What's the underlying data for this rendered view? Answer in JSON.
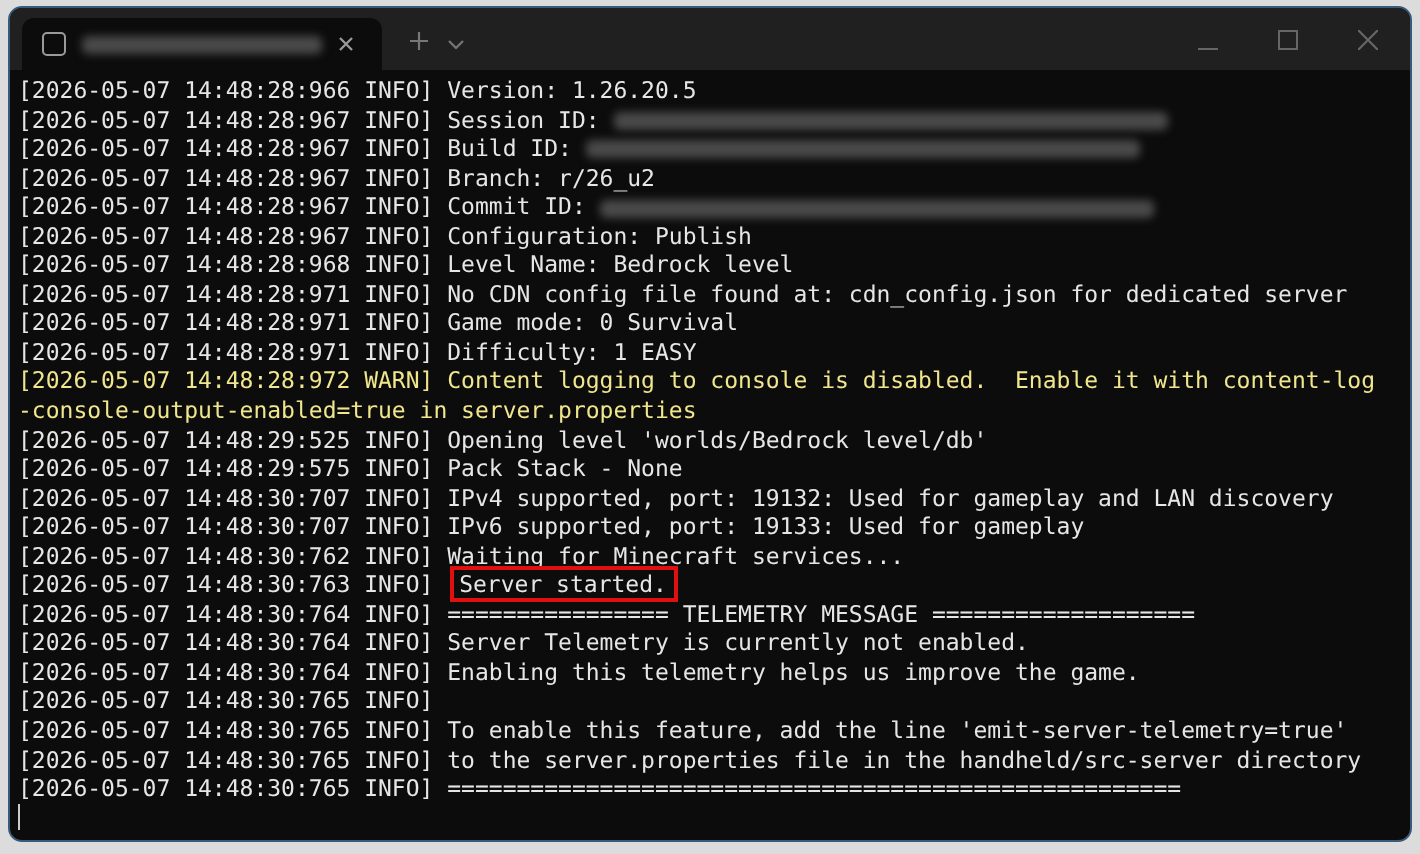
{
  "window": {
    "tab": {
      "title_redacted": true,
      "selected": true
    }
  },
  "console": {
    "lines": [
      {
        "time": "[2026-05-07 14:48:28:966",
        "level": "INFO]",
        "message": "Version: 1.26.20.5"
      },
      {
        "time": "[2026-05-07 14:48:28:967",
        "level": "INFO]",
        "message": "Session ID:",
        "redacted": true
      },
      {
        "time": "[2026-05-07 14:48:28:967",
        "level": "INFO]",
        "message": "Build ID:",
        "redacted": true
      },
      {
        "time": "[2026-05-07 14:48:28:967",
        "level": "INFO]",
        "message": "Branch: r/26_u2"
      },
      {
        "time": "[2026-05-07 14:48:28:967",
        "level": "INFO]",
        "message": "Commit ID:",
        "redacted": true
      },
      {
        "time": "[2026-05-07 14:48:28:967",
        "level": "INFO]",
        "message": "Configuration: Publish"
      },
      {
        "time": "[2026-05-07 14:48:28:968",
        "level": "INFO]",
        "message": "Level Name: Bedrock level"
      },
      {
        "time": "[2026-05-07 14:48:28:971",
        "level": "INFO]",
        "message": "No CDN config file found at: cdn_config.json for dedicated server"
      },
      {
        "time": "[2026-05-07 14:48:28:971",
        "level": "INFO]",
        "message": "Game mode: 0 Survival"
      },
      {
        "time": "[2026-05-07 14:48:28:971",
        "level": "INFO]",
        "message": "Difficulty: 1 EASY"
      },
      {
        "time": "[2026-05-07 14:48:28:972",
        "level": "WARN]",
        "message": "Content logging to console is disabled.  Enable it with content-log-console-output-enabled=true in server.properties"
      },
      {
        "time": "[2026-05-07 14:48:29:525",
        "level": "INFO]",
        "message": "Opening level 'worlds/Bedrock level/db'"
      },
      {
        "time": "[2026-05-07 14:48:29:575",
        "level": "INFO]",
        "message": "Pack Stack - None"
      },
      {
        "time": "[2026-05-07 14:48:30:707",
        "level": "INFO]",
        "message": "IPv4 supported, port: 19132: Used for gameplay and LAN discovery"
      },
      {
        "time": "[2026-05-07 14:48:30:707",
        "level": "INFO]",
        "message": "IPv6 supported, port: 19133: Used for gameplay"
      },
      {
        "time": "[2026-05-07 14:48:30:762",
        "level": "INFO]",
        "message": "Waiting for Minecraft services..."
      },
      {
        "time": "[2026-05-07 14:48:30:763",
        "level": "INFO]",
        "message": "Server started.",
        "highlighted": true
      },
      {
        "time": "[2026-05-07 14:48:30:764",
        "level": "INFO]",
        "message": "================ TELEMETRY MESSAGE ==================="
      },
      {
        "time": "[2026-05-07 14:48:30:764",
        "level": "INFO]",
        "message": "Server Telemetry is currently not enabled."
      },
      {
        "time": "[2026-05-07 14:48:30:764",
        "level": "INFO]",
        "message": "Enabling this telemetry helps us improve the game."
      },
      {
        "time": "[2026-05-07 14:48:30:765",
        "level": "INFO]"
      },
      {
        "time": "[2026-05-07 14:48:30:765",
        "level": "INFO]",
        "message": "To enable this feature, add the line 'emit-server-telemetry=true'"
      },
      {
        "time": "[2026-05-07 14:48:30:765",
        "level": "INFO]",
        "message": "to the server.properties file in the handheld/src-server directory"
      },
      {
        "time": "[2026-05-07 14:48:30:765",
        "level": "INFO]",
        "message": "====================================================="
      }
    ]
  }
}
